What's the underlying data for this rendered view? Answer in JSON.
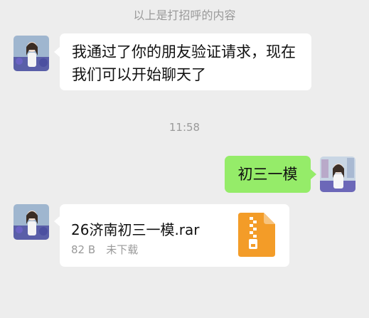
{
  "system_notice": "以上是打招呼的内容",
  "timestamp": "11:58",
  "messages": {
    "received_text": {
      "line1": "我通过了你的朋友验证请求，现在",
      "line2": "我们可以开始聊天了"
    },
    "sent_text": "初三一模",
    "received_file": {
      "name": "26济南初三一模.rar",
      "size": "82 B",
      "status": "未下载",
      "icon": "zip-file-icon"
    }
  },
  "colors": {
    "background": "#ededed",
    "sent_bubble": "#95ec69",
    "received_bubble": "#ffffff",
    "file_icon": "#f39c28"
  }
}
